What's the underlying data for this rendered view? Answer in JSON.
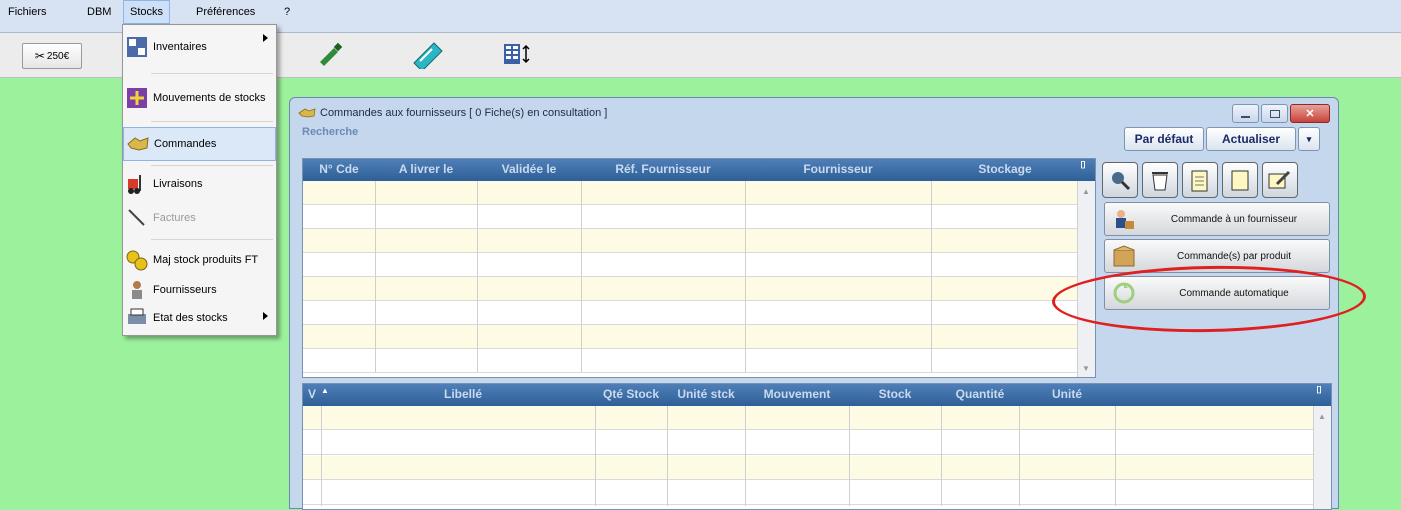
{
  "menubar": {
    "items": [
      "Fichiers",
      "DBM",
      "Stocks",
      "Préférences",
      "?"
    ]
  },
  "toolbar": {
    "btn250_label": "250€"
  },
  "stocks_menu": {
    "items": [
      {
        "label": "Inventaires",
        "submenu": true
      },
      {
        "label": "Mouvements de stocks"
      },
      {
        "label": "Commandes"
      },
      {
        "label": "Livraisons"
      },
      {
        "label": "Factures",
        "disabled": true
      },
      {
        "label": "Maj stock produits FT"
      },
      {
        "label": "Fournisseurs"
      },
      {
        "label": "Etat des stocks",
        "submenu": true
      }
    ]
  },
  "window": {
    "title": "Commandes aux fournisseurs  [ 0 Fiche(s) en consultation ]",
    "subtitle": "Recherche",
    "btn_default": "Par défaut",
    "btn_refresh": "Actualiser"
  },
  "grid_top": {
    "columns": [
      "N° Cde",
      "A livrer le",
      "Validée le",
      "Réf. Fournisseur",
      "Fournisseur",
      "Stockage"
    ],
    "row_count": 8
  },
  "grid_bottom": {
    "columns": [
      "V",
      "Libellé",
      "Qté Stock",
      "Unité stck",
      "Mouvement",
      "Stock",
      "Quantité",
      "Unité"
    ]
  },
  "actions": {
    "cmd_fournisseur": "Commande à un fournisseur",
    "cmd_produit": "Commande(s) par produit",
    "cmd_auto": "Commande automatique"
  },
  "colors": {
    "background": "#9cf29c",
    "grid_header": "#3d6ea8",
    "highlight_ellipse": "#e02020",
    "row_alt": "#fdfbe3"
  }
}
